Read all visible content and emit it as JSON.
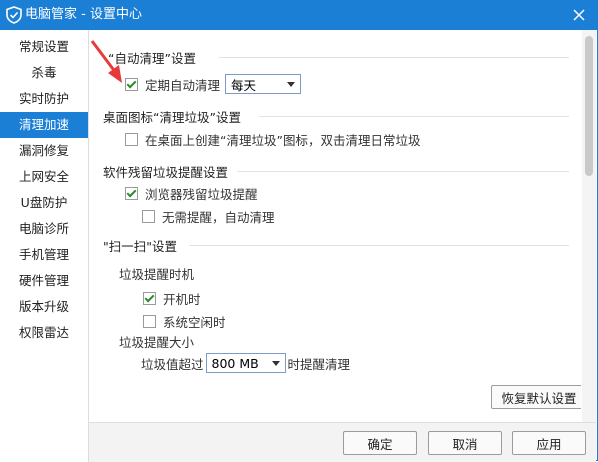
{
  "window": {
    "title": "电脑管家 - 设置中心",
    "logo_icon": "shield-icon",
    "close_icon": "close-icon"
  },
  "sidebar": {
    "items": [
      {
        "label": "常规设置",
        "active": false
      },
      {
        "label": "杀毒",
        "active": false
      },
      {
        "label": "实时防护",
        "active": false
      },
      {
        "label": "清理加速",
        "active": true
      },
      {
        "label": "漏洞修复",
        "active": false
      },
      {
        "label": "上网安全",
        "active": false
      },
      {
        "label": "U盘防护",
        "active": false
      },
      {
        "label": "电脑诊所",
        "active": false
      },
      {
        "label": "手机管理",
        "active": false
      },
      {
        "label": "硬件管理",
        "active": false
      },
      {
        "label": "版本升级",
        "active": false
      },
      {
        "label": "权限雷达",
        "active": false
      }
    ]
  },
  "auto_clean": {
    "title": "“自动清理”设置",
    "option_label": "定期自动清理",
    "checked": true,
    "frequency": "每天"
  },
  "desktop_icon": {
    "title": "桌面图标“清理垃圾”设置",
    "option_label": "在桌面上创建“清理垃圾”图标，双击清理日常垃圾",
    "checked": false
  },
  "software_residue": {
    "title": "软件残留垃圾提醒设置",
    "browser_label": "浏览器残留垃圾提醒",
    "browser_checked": true,
    "auto_label": "无需提醒，自动清理",
    "auto_checked": false
  },
  "scan": {
    "title": "\"扫一扫\"设置",
    "timing_label": "垃圾提醒时机",
    "startup_label": "开机时",
    "startup_checked": true,
    "idle_label": "系统空闲时",
    "idle_checked": false,
    "size_label": "垃圾提醒大小",
    "size_prefix": "垃圾值超过",
    "size_value": "800 MB",
    "size_suffix": "时提醒清理"
  },
  "buttons": {
    "restore": "恢复默认设置",
    "ok": "确定",
    "cancel": "取消",
    "apply": "应用"
  },
  "colors": {
    "accent": "#1b7fd6",
    "check": "#2a8d2a",
    "arrow": "#e83a3a"
  }
}
